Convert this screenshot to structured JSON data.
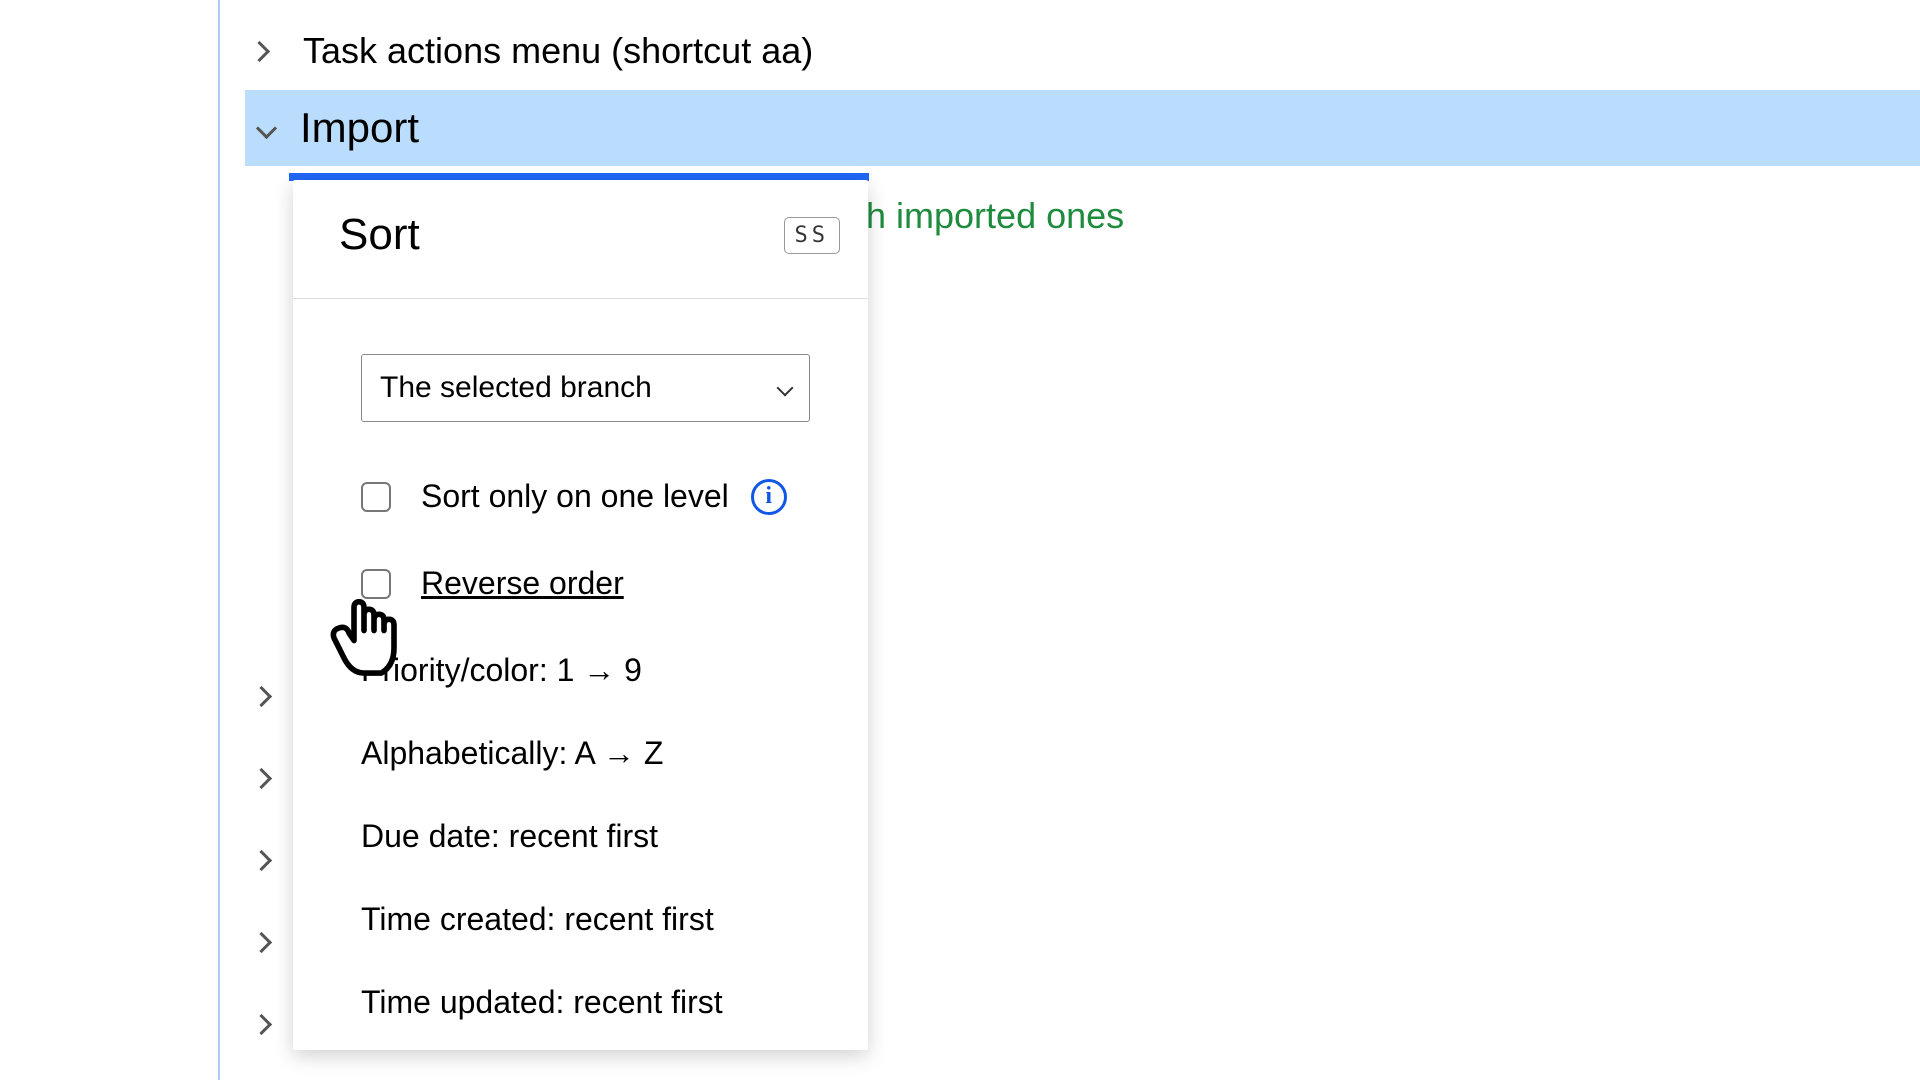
{
  "tree": {
    "item1": "Task actions menu (shortcut aa)",
    "item2": "Import"
  },
  "subtitle_trail": "h imported ones",
  "sort": {
    "title": "Sort",
    "shortcut": "SS",
    "scope": "The selected branch",
    "one_level_label": "Sort only on one level",
    "reverse_label": " Reverse order",
    "options": {
      "priority": "Priority/color: 1 → 9",
      "alpha": "Alphabetically: A → Z",
      "due": "Due date: recent first",
      "created": "Time created: recent first",
      "updated": "Time updated: recent first"
    }
  }
}
